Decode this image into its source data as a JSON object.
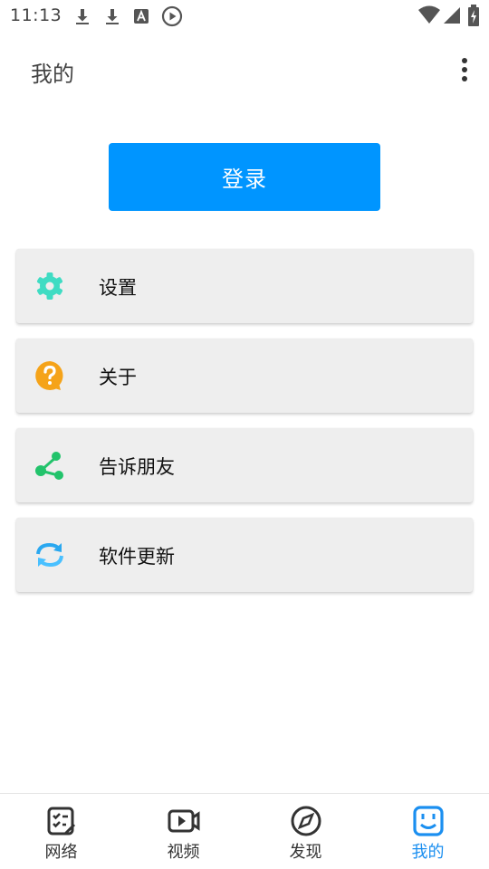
{
  "status_bar": {
    "time": "11:13",
    "icons": [
      "download-icon",
      "download-icon",
      "a-icon",
      "play-circle-icon",
      "wifi-icon",
      "signal-icon",
      "battery-charging-icon"
    ]
  },
  "app_bar": {
    "title": "我的",
    "menu_icon": "overflow-menu-icon"
  },
  "login": {
    "label": "登录",
    "color": "#0095ff"
  },
  "menu": [
    {
      "label": "设置",
      "icon": "gear-icon",
      "color": "#3fdcc3"
    },
    {
      "label": "关于",
      "icon": "help-icon",
      "color": "#f5a319"
    },
    {
      "label": "告诉朋友",
      "icon": "share-icon",
      "color": "#22c36b"
    },
    {
      "label": "软件更新",
      "icon": "refresh-icon",
      "color": "#2aa8f0"
    }
  ],
  "bottom_nav": [
    {
      "label": "网络",
      "icon": "network-icon",
      "active": false
    },
    {
      "label": "视频",
      "icon": "video-icon",
      "active": false
    },
    {
      "label": "发现",
      "icon": "compass-icon",
      "active": false
    },
    {
      "label": "我的",
      "icon": "smiley-icon",
      "active": true
    }
  ],
  "colors": {
    "accent": "#1b8ff0",
    "card_bg": "#eeeeee"
  }
}
